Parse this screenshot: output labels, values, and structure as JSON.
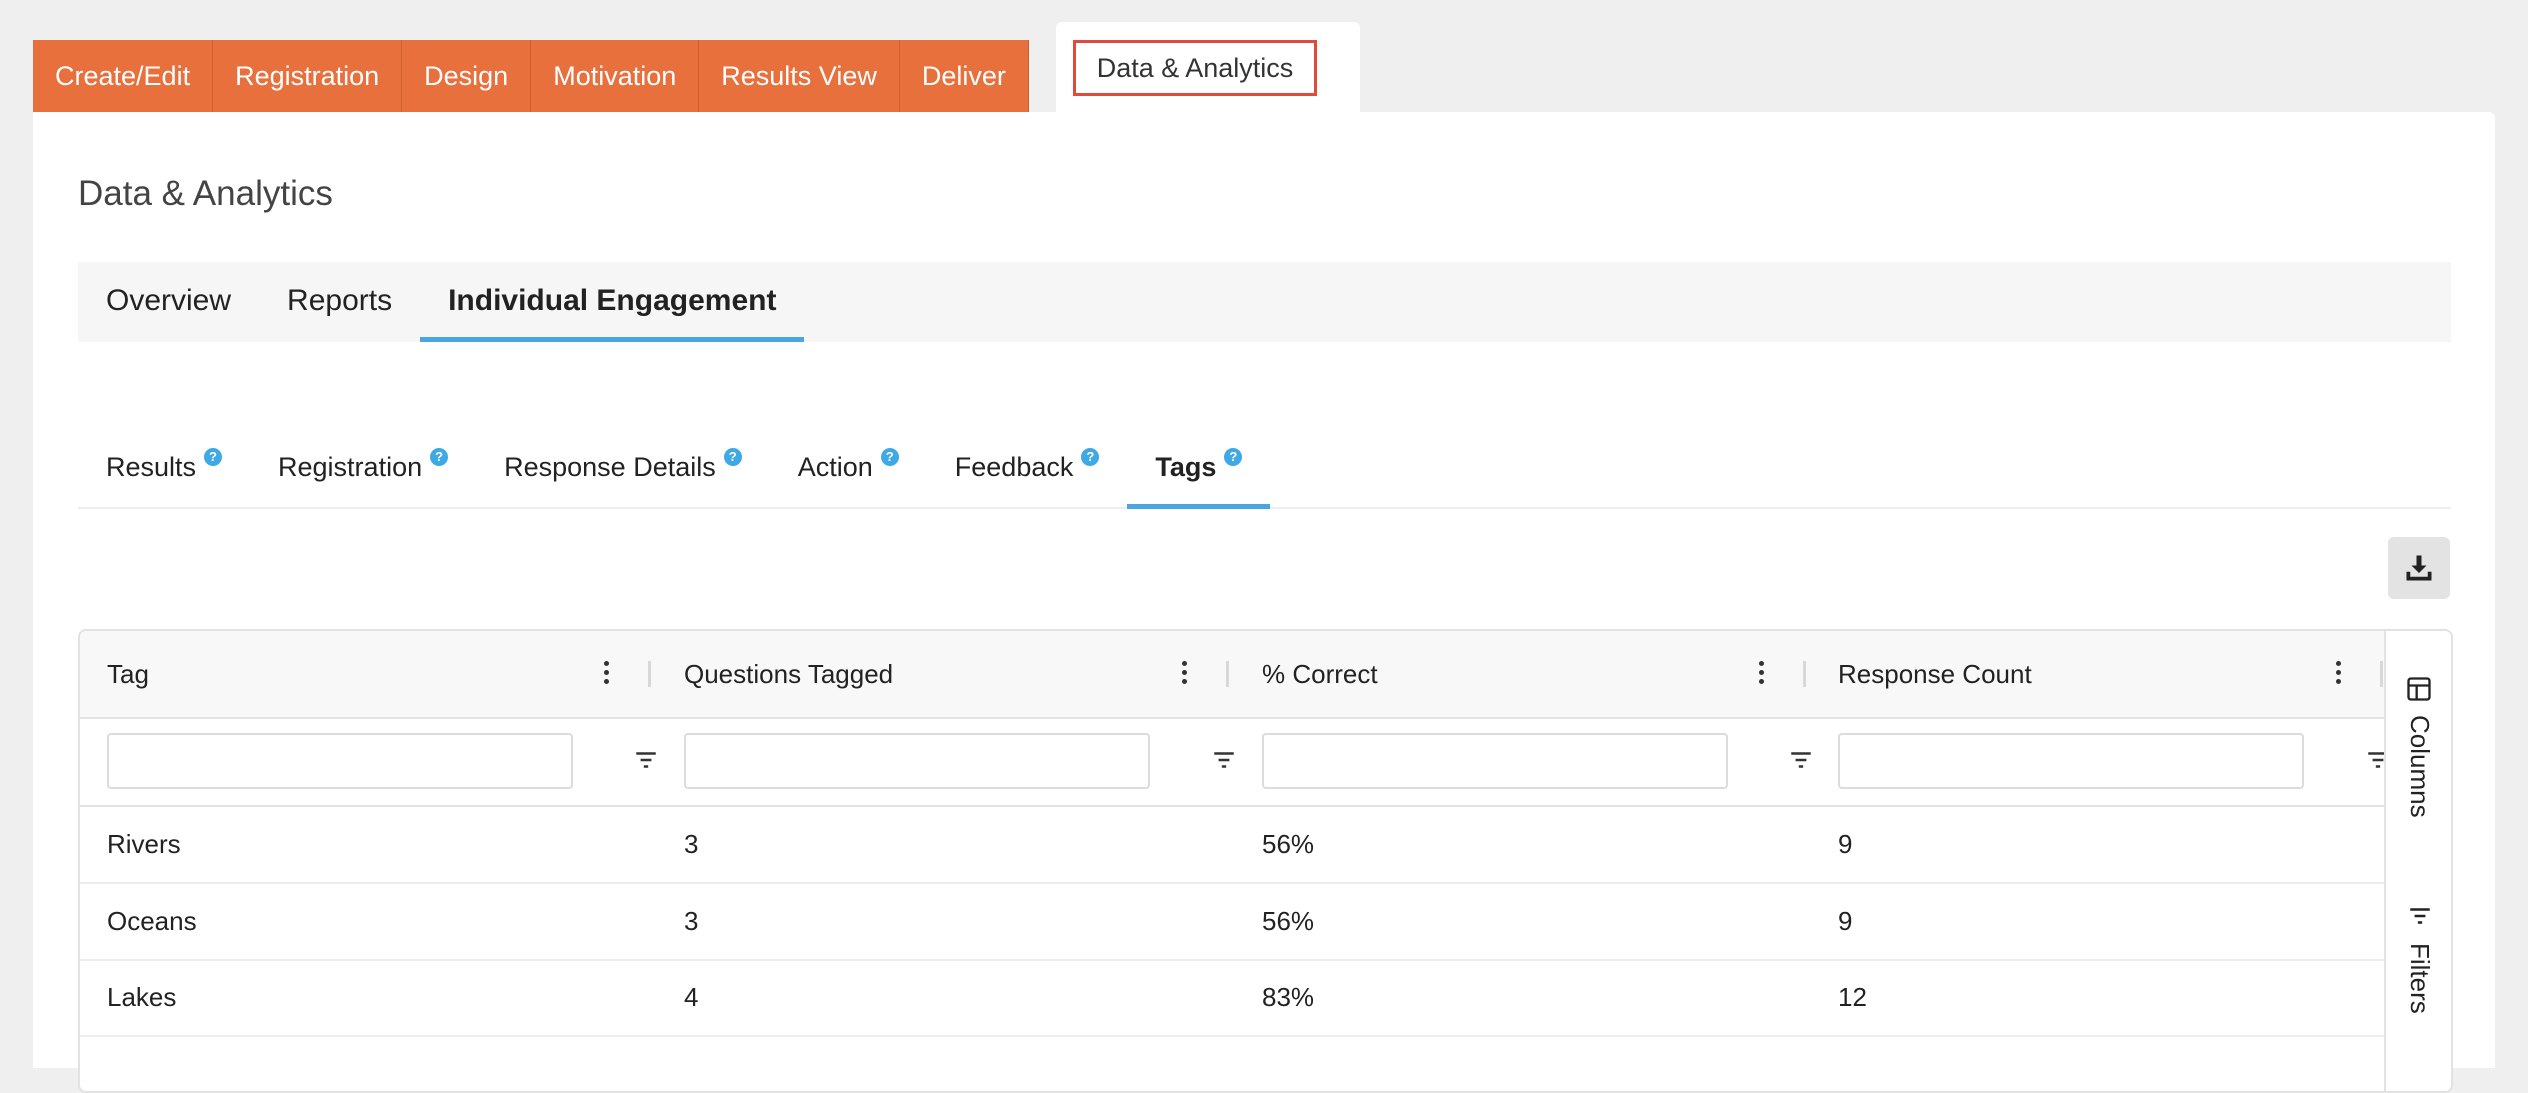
{
  "topnav": {
    "tabs": [
      "Create/Edit",
      "Registration",
      "Design",
      "Motivation",
      "Results View",
      "Deliver"
    ],
    "active": "Data & Analytics",
    "accent": "#e8703d",
    "highlight": "#e04a3b"
  },
  "page": {
    "title": "Data & Analytics"
  },
  "subnav": {
    "tabs": [
      "Overview",
      "Reports",
      "Individual Engagement"
    ],
    "active_index": 2
  },
  "detail_tabs": {
    "tabs": [
      "Results",
      "Registration",
      "Response Details",
      "Action",
      "Feedback",
      "Tags"
    ],
    "active_index": 5,
    "help_glyph": "?"
  },
  "toolbar": {
    "download_icon": "download-icon"
  },
  "grid": {
    "columns": [
      "Tag",
      "Questions Tagged",
      "% Correct",
      "Response Count"
    ],
    "rows": [
      [
        "Rivers",
        "3",
        "56%",
        "9"
      ],
      [
        "Oceans",
        "3",
        "56%",
        "9"
      ],
      [
        "Lakes",
        "4",
        "83%",
        "12"
      ]
    ],
    "filters": [
      "",
      "",
      "",
      ""
    ],
    "side_panel": {
      "columns_label": "Columns",
      "filters_label": "Filters"
    }
  }
}
